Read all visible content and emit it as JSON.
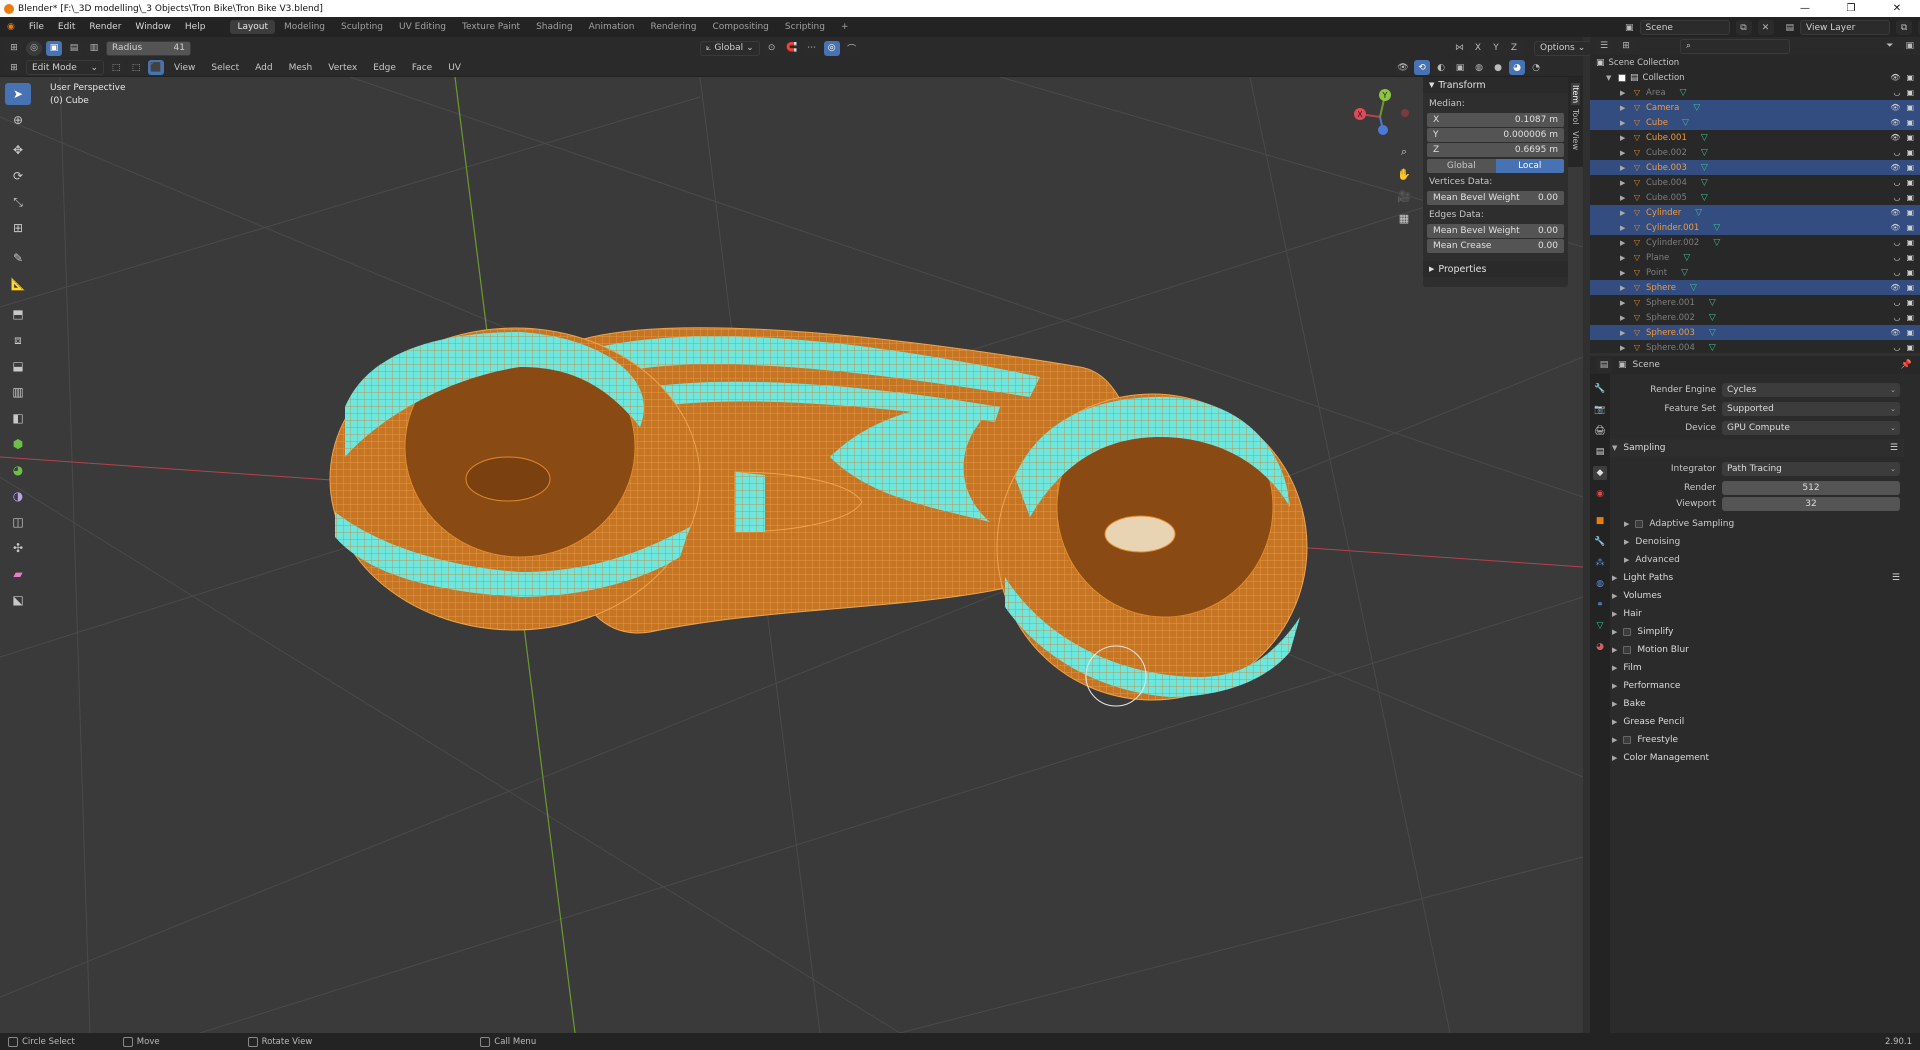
{
  "window": {
    "title": "Blender* [F:\\_3D modelling\\_3 Objects\\Tron Bike\\Tron Bike V3.blend]",
    "controls": [
      "—",
      "❐",
      "✕"
    ]
  },
  "menubar": {
    "items": [
      "File",
      "Edit",
      "Render",
      "Window",
      "Help"
    ],
    "workspaces": [
      "Layout",
      "Modeling",
      "Sculpting",
      "UV Editing",
      "Texture Paint",
      "Shading",
      "Animation",
      "Rendering",
      "Compositing",
      "Scripting"
    ],
    "active_workspace": "Layout",
    "add_tab": "+",
    "scene": "Scene",
    "view_layer": "View Layer"
  },
  "tool_header": {
    "radius_label": "Radius",
    "radius_value": "41",
    "orientation": "Global",
    "axes": [
      "X",
      "Y",
      "Z"
    ],
    "options": "Options"
  },
  "mode_header": {
    "mode": "Edit Mode",
    "menus": [
      "View",
      "Select",
      "Add",
      "Mesh",
      "Vertex",
      "Edge",
      "Face",
      "UV"
    ]
  },
  "viewport": {
    "perspective": "User Perspective",
    "object": "(0) Cube",
    "gizmo": {
      "x": "X",
      "y": "Y",
      "z": "Z"
    },
    "colors": {
      "mesh": "#e08a2b",
      "selected_faces": "#6ee8de",
      "bg": "#3a3a3a",
      "x_axis": "#b5424f",
      "y_axis": "#6b9a2a"
    }
  },
  "npanel": {
    "title": "Transform",
    "median_label": "Median:",
    "coords": [
      {
        "axis": "X",
        "value": "0.1087 m"
      },
      {
        "axis": "Y",
        "value": "0.000006 m"
      },
      {
        "axis": "Z",
        "value": "0.6695 m"
      }
    ],
    "space_global": "Global",
    "space_local": "Local",
    "vertices_data": "Vertices Data:",
    "vertex_bevel_label": "Mean Bevel Weight",
    "vertex_bevel_value": "0.00",
    "edges_data": "Edges Data:",
    "edge_bevel_label": "Mean Bevel Weight",
    "edge_bevel_value": "0.00",
    "crease_label": "Mean Crease",
    "crease_value": "0.00",
    "properties": "Properties",
    "tabs": [
      "Item",
      "Tool",
      "View"
    ]
  },
  "outliner": {
    "search_placeholder": "",
    "scene_collection": "Scene Collection",
    "collection": "Collection",
    "items": [
      {
        "name": "Area",
        "selected": false,
        "dim": true
      },
      {
        "name": "Camera",
        "selected": true,
        "dim": false
      },
      {
        "name": "Cube",
        "selected": true,
        "dim": false
      },
      {
        "name": "Cube.001",
        "selected": false,
        "dim": false
      },
      {
        "name": "Cube.002",
        "selected": false,
        "dim": true
      },
      {
        "name": "Cube.003",
        "selected": true,
        "dim": false
      },
      {
        "name": "Cube.004",
        "selected": false,
        "dim": true
      },
      {
        "name": "Cube.005",
        "selected": false,
        "dim": true
      },
      {
        "name": "Cylinder",
        "selected": true,
        "dim": false
      },
      {
        "name": "Cylinder.001",
        "selected": true,
        "dim": false
      },
      {
        "name": "Cylinder.002",
        "selected": false,
        "dim": true
      },
      {
        "name": "Plane",
        "selected": false,
        "dim": true
      },
      {
        "name": "Point",
        "selected": false,
        "dim": true
      },
      {
        "name": "Sphere",
        "selected": true,
        "dim": false
      },
      {
        "name": "Sphere.001",
        "selected": false,
        "dim": true
      },
      {
        "name": "Sphere.002",
        "selected": false,
        "dim": true
      },
      {
        "name": "Sphere.003",
        "selected": true,
        "dim": false
      },
      {
        "name": "Sphere.004",
        "selected": false,
        "dim": true
      }
    ]
  },
  "properties": {
    "context": "Scene",
    "render_engine_label": "Render Engine",
    "render_engine": "Cycles",
    "feature_set_label": "Feature Set",
    "feature_set": "Supported",
    "device_label": "Device",
    "device": "GPU Compute",
    "sampling": "Sampling",
    "integrator_label": "Integrator",
    "integrator": "Path Tracing",
    "render_label": "Render",
    "render_samples": "512",
    "viewport_label": "Viewport",
    "viewport_samples": "32",
    "subsections": [
      "Adaptive Sampling",
      "Denoising",
      "Advanced"
    ],
    "sections": [
      "Light Paths",
      "Volumes",
      "Hair",
      "Simplify",
      "Motion Blur",
      "Film",
      "Performance",
      "Bake",
      "Grease Pencil",
      "Freestyle",
      "Color Management"
    ]
  },
  "statusbar": {
    "items": [
      "Circle Select",
      "Move",
      "Rotate View",
      "Call Menu"
    ],
    "version": "2.90.1"
  }
}
